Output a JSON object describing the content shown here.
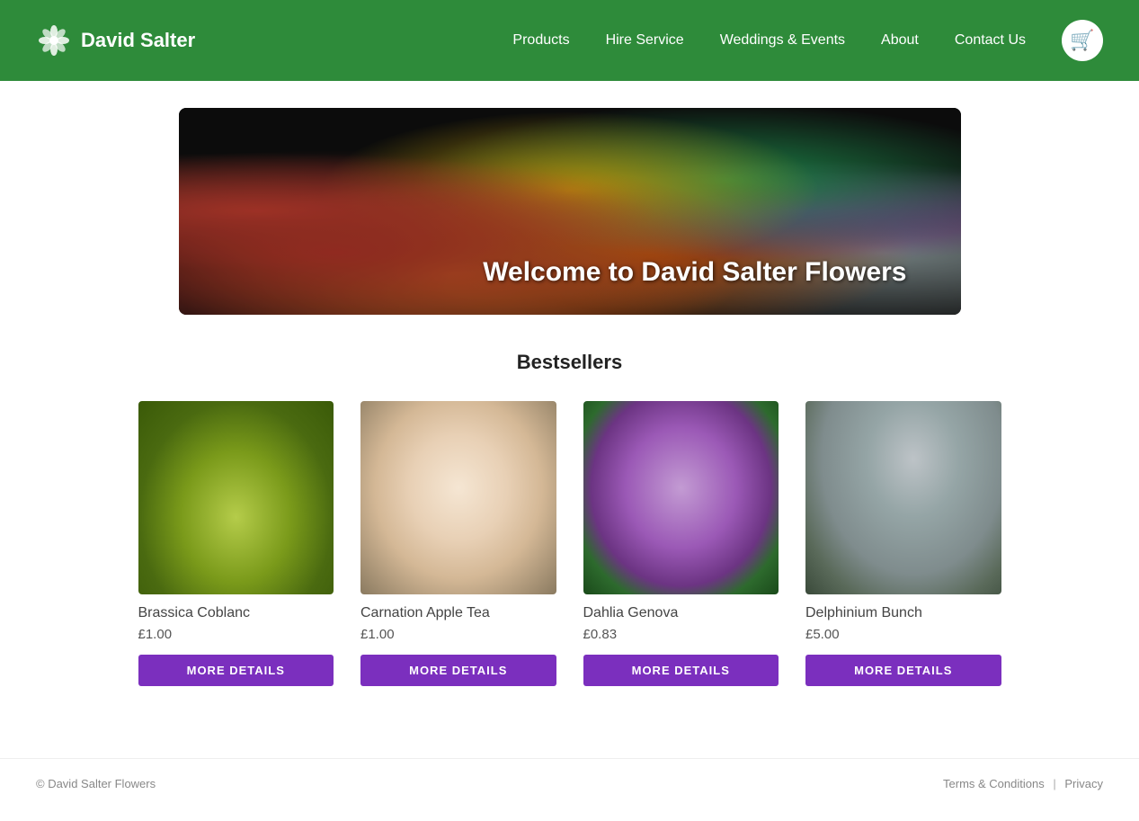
{
  "header": {
    "brand": "David Salter",
    "nav": [
      {
        "label": "Products",
        "href": "#"
      },
      {
        "label": "Hire Service",
        "href": "#"
      },
      {
        "label": "Weddings & Events",
        "href": "#"
      },
      {
        "label": "About",
        "href": "#"
      },
      {
        "label": "Contact Us",
        "href": "#"
      }
    ],
    "cart_icon": "🛒"
  },
  "hero": {
    "welcome_text": "Welcome to David Salter Flowers"
  },
  "bestsellers": {
    "title": "Bestsellers",
    "products": [
      {
        "name": "Brassica Coblanc",
        "price": "£1.00",
        "btn_label": "MORE DETAILS",
        "img_class": "flower-brassica"
      },
      {
        "name": "Carnation Apple Tea",
        "price": "£1.00",
        "btn_label": "MORE DETAILS",
        "img_class": "flower-carnation"
      },
      {
        "name": "Dahlia Genova",
        "price": "£0.83",
        "btn_label": "MORE DETAILS",
        "img_class": "flower-dahlia"
      },
      {
        "name": "Delphinium Bunch",
        "price": "£5.00",
        "btn_label": "MORE DETAILS",
        "img_class": "flower-delphinium"
      }
    ]
  },
  "footer": {
    "copyright": "© David Salter Flowers",
    "links": [
      {
        "label": "Terms & Conditions",
        "href": "#"
      },
      {
        "label": "Privacy",
        "href": "#"
      }
    ]
  }
}
